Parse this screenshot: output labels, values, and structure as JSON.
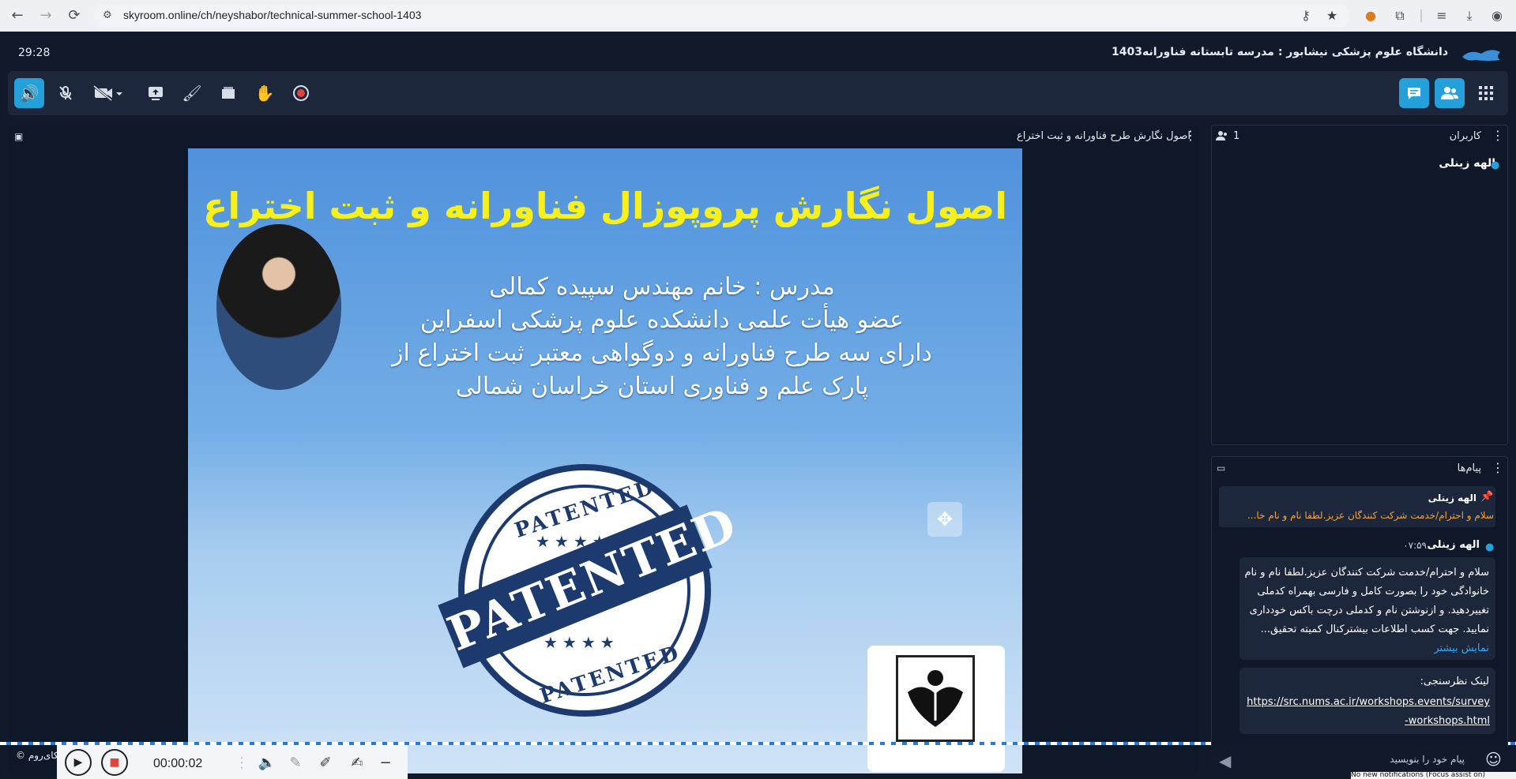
{
  "browser": {
    "url": "skyroom.online/ch/neyshabor/technical-summer-school-1403",
    "back": "←",
    "forward": "→",
    "reload": "⟳"
  },
  "header": {
    "timer": "29:28",
    "room_title": "دانشگاه علوم پزشکی نیشابور : مدرسه تابستانه فناورانه1403"
  },
  "presentation": {
    "title": "اصول نگارش طرح فناورانه و ثبت اختراع",
    "slide": {
      "title": "اصول نگارش پروپوزال فناورانه و ثبت اختراع",
      "lines": [
        "مدرس : خانم مهندس سپیده کمالی",
        "عضو هیأت علمی دانشکده علوم پزشکی اسفراین",
        "دارای سه طرح فناورانه و دوگواهی معتبر ثبت اختراع از",
        "پارک علم و فناوری استان خراسان شمالی"
      ],
      "stamp_word": "PATENTED",
      "stamp_top": "PATENTED",
      "stamp_bottom": "PATENTED"
    }
  },
  "playback": {
    "time": "00:00:02",
    "brand": "© اسکای‌روم"
  },
  "users": {
    "title": "کاربران",
    "count": "1",
    "list": [
      "الهه زینلی"
    ]
  },
  "messages": {
    "title": "پیام‌ها",
    "pinned_author": "الهه زینلی",
    "pinned_text": "سلام و احترام/خدمت شرکت کنندگان عزیز.لطفا نام و نام خا...",
    "author": "الهه زینلی",
    "time": "۰۷:۵۹",
    "body": "سلام و احترام/خدمت شرکت کنندگان عزیز.لطفا نام و نام خانوادگی خود را بصورت کامل و فارسی بهمراه کدملی تغییردهید. و ازنوشتن نام و کدملی درچت باکس خودداری نمایید. جهت کسب اطلاعات بیشترکنال کمیته تحقیق...",
    "more": "نمایش بیشتر",
    "link_label": "لینک نظرسنجی:",
    "link_url": "https://src.nums.ac.ir/workshops.events/survey-workshops.html",
    "input_placeholder": "پیام خود را بنویسید"
  },
  "toast": "No new notifications (Focus assist on)",
  "colors": {
    "accent": "#24a0db",
    "panel": "#0f1828",
    "pinned_text": "#f4a43a",
    "slide_title": "#f7f01a"
  }
}
